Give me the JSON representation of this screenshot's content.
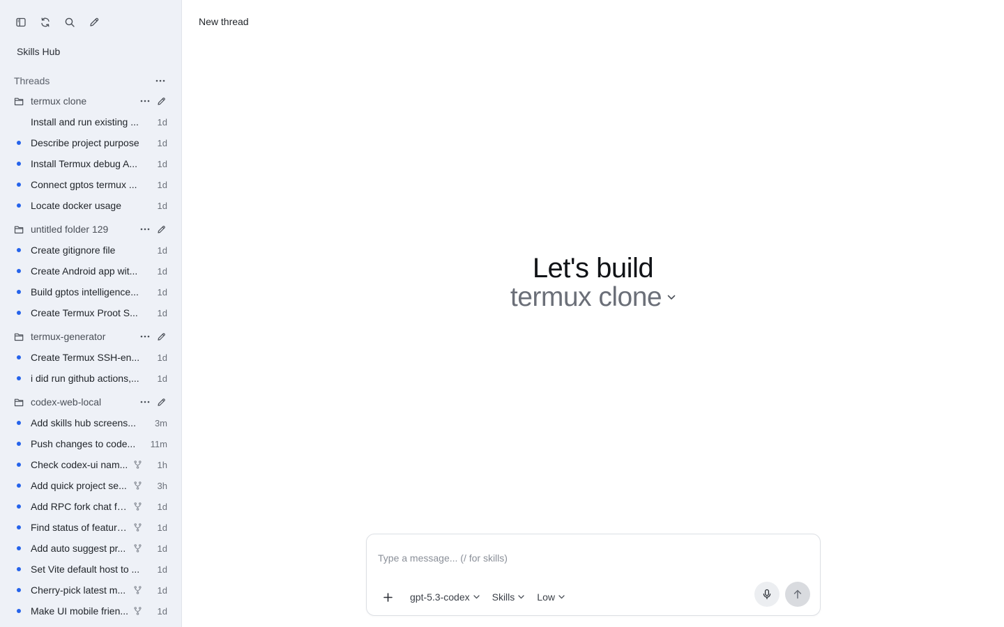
{
  "sidebar": {
    "toolbar": [
      {
        "name": "sidebar-toggle-icon"
      },
      {
        "name": "refresh-icon"
      },
      {
        "name": "search-icon"
      },
      {
        "name": "new-thread-icon"
      }
    ],
    "skills_hub_label": "Skills Hub",
    "threads_label": "Threads",
    "groups": [
      {
        "folder": "termux clone",
        "threads": [
          {
            "title": "Install and run existing ...",
            "time": "1d",
            "unread": false,
            "forked": false
          },
          {
            "title": "Describe project purpose",
            "time": "1d",
            "unread": true,
            "forked": false
          },
          {
            "title": "Install Termux debug A...",
            "time": "1d",
            "unread": true,
            "forked": false
          },
          {
            "title": "Connect gptos termux ...",
            "time": "1d",
            "unread": true,
            "forked": false
          },
          {
            "title": "Locate docker usage",
            "time": "1d",
            "unread": true,
            "forked": false
          }
        ]
      },
      {
        "folder": "untitled folder 129",
        "threads": [
          {
            "title": "Create gitignore file",
            "time": "1d",
            "unread": true,
            "forked": false
          },
          {
            "title": "Create Android app wit...",
            "time": "1d",
            "unread": true,
            "forked": false
          },
          {
            "title": "Build gptos intelligence...",
            "time": "1d",
            "unread": true,
            "forked": false
          },
          {
            "title": "Create Termux Proot S...",
            "time": "1d",
            "unread": true,
            "forked": false
          }
        ]
      },
      {
        "folder": "termux-generator",
        "threads": [
          {
            "title": "Create Termux SSH-en...",
            "time": "1d",
            "unread": true,
            "forked": false
          },
          {
            "title": "i did run github actions,...",
            "time": "1d",
            "unread": true,
            "forked": false
          }
        ]
      },
      {
        "folder": "codex-web-local",
        "threads": [
          {
            "title": "Add skills hub screens...",
            "time": "3m",
            "unread": true,
            "forked": false
          },
          {
            "title": "Push changes to code...",
            "time": "11m",
            "unread": true,
            "forked": false
          },
          {
            "title": "Check codex-ui nam...",
            "time": "1h",
            "unread": true,
            "forked": true
          },
          {
            "title": "Add quick project se...",
            "time": "3h",
            "unread": true,
            "forked": true
          },
          {
            "title": "Add RPC fork chat fe...",
            "time": "1d",
            "unread": true,
            "forked": true
          },
          {
            "title": "Find status of feature...",
            "time": "1d",
            "unread": true,
            "forked": true
          },
          {
            "title": "Add auto suggest pr...",
            "time": "1d",
            "unread": true,
            "forked": true
          },
          {
            "title": "Set Vite default host to ...",
            "time": "1d",
            "unread": true,
            "forked": false
          },
          {
            "title": "Cherry-pick latest m...",
            "time": "1d",
            "unread": true,
            "forked": true
          },
          {
            "title": "Make UI mobile frien...",
            "time": "1d",
            "unread": true,
            "forked": true
          }
        ]
      }
    ]
  },
  "main": {
    "title": "New thread",
    "hero_title": "Let's build",
    "hero_project": "termux clone"
  },
  "composer": {
    "placeholder": "Type a message... (/ for skills)",
    "value": "",
    "model": "gpt-5.3-codex",
    "skills": "Skills",
    "effort": "Low"
  },
  "colors": {
    "sidebar_bg": "#eef1f7",
    "unread_dot": "#2563eb",
    "muted_text": "#6b6f78"
  }
}
